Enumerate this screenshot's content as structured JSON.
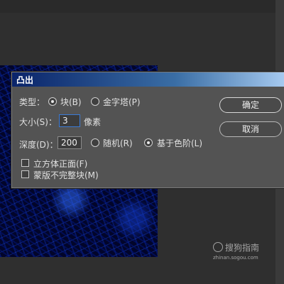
{
  "dialog": {
    "title": "凸出",
    "type_label": "类型：",
    "type_options": [
      {
        "label": "块(B)",
        "selected": true
      },
      {
        "label": "金字塔(P)",
        "selected": false
      }
    ],
    "size_label": "大小(S)：",
    "size_value": "3",
    "size_unit": "像素",
    "depth_label": "深度(D)：",
    "depth_value": "200",
    "depth_options": [
      {
        "label": "随机(R)",
        "selected": false
      },
      {
        "label": "基于色阶(L)",
        "selected": true
      }
    ],
    "checkboxes": [
      {
        "label": "立方体正面(F)",
        "checked": false
      },
      {
        "label": "蒙版不完整块(M)",
        "checked": false
      }
    ],
    "ok_label": "确定",
    "cancel_label": "取消"
  },
  "watermark": {
    "brand": "搜狗指南",
    "domain": "zhinan.sogou.com"
  }
}
